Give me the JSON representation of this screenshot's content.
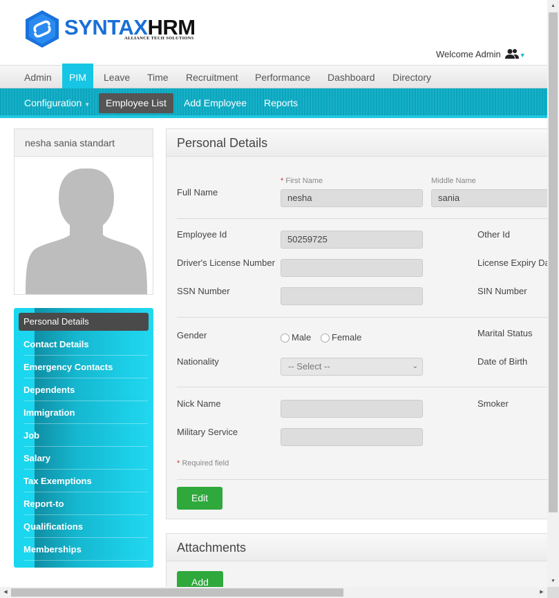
{
  "brand": {
    "name_part1": "SYNTAX",
    "name_part2": "HRM",
    "tagline": "ALLIANCE TECH SOLUTIONS",
    "accent": "#16c6e4",
    "logo_blue": "#1a6fd6"
  },
  "welcome": {
    "text": "Welcome Admin",
    "icon": "users-icon"
  },
  "top_nav": {
    "items": [
      "Admin",
      "PIM",
      "Leave",
      "Time",
      "Recruitment",
      "Performance",
      "Dashboard",
      "Directory"
    ],
    "active": "PIM"
  },
  "sub_nav": {
    "items": [
      "Configuration",
      "Employee List",
      "Add Employee",
      "Reports"
    ],
    "active": "Employee List"
  },
  "employee": {
    "display_name": "nesha sania standart"
  },
  "side_menu": {
    "items": [
      "Personal Details",
      "Contact Details",
      "Emergency Contacts",
      "Dependents",
      "Immigration",
      "Job",
      "Salary",
      "Tax Exemptions",
      "Report-to",
      "Qualifications",
      "Memberships"
    ],
    "active": "Personal Details"
  },
  "personal_details": {
    "title": "Personal Details",
    "full_name_label": "Full Name",
    "first_name_label": "First Name",
    "first_name_required": "*",
    "middle_name_label": "Middle Name",
    "first_name": "nesha",
    "middle_name": "sania",
    "employee_id_label": "Employee Id",
    "employee_id": "50259725",
    "other_id_label": "Other Id",
    "drivers_license_label": "Driver's License Number",
    "license_expiry_label": "License Expiry Date",
    "ssn_label": "SSN Number",
    "sin_label": "SIN Number",
    "gender_label": "Gender",
    "gender_male": "Male",
    "gender_female": "Female",
    "marital_status_label": "Marital Status",
    "nationality_label": "Nationality",
    "nationality_value": "-- Select --",
    "dob_label": "Date of Birth",
    "nick_name_label": "Nick Name",
    "smoker_label": "Smoker",
    "military_label": "Military Service",
    "required_star": "*",
    "required_note": "Required field",
    "edit_button": "Edit"
  },
  "attachments": {
    "title": "Attachments",
    "add_button": "Add"
  }
}
